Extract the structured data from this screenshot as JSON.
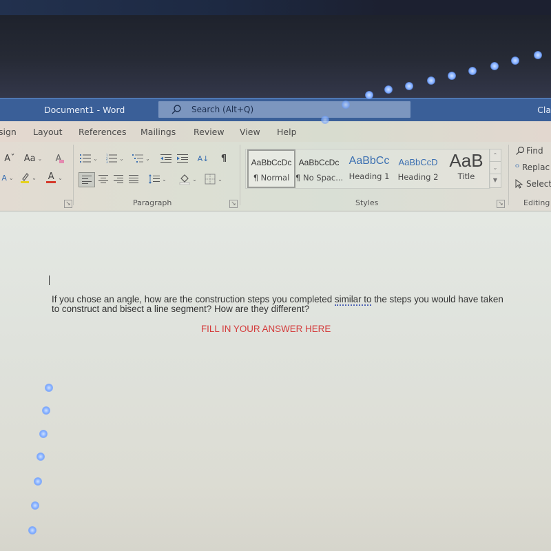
{
  "window": {
    "doc_title": "Document1  -  Word",
    "search_placeholder": "Search (Alt+Q)",
    "user_name_partial": "Cla"
  },
  "ribbon_tabs": [
    {
      "label": "sign"
    },
    {
      "label": "Layout"
    },
    {
      "label": "References"
    },
    {
      "label": "Mailings"
    },
    {
      "label": "Review"
    },
    {
      "label": "View"
    },
    {
      "label": "Help"
    }
  ],
  "font_group": {
    "grow_font": "Aˇ",
    "change_case": "Aa",
    "clear_formatting": "A",
    "font_color": "A",
    "highlight_color": "#e6d21e",
    "font_color_swatch": "#d53a2b"
  },
  "paragraph_group": {
    "label": "Paragraph",
    "sort": "A↓",
    "show_marks": "¶"
  },
  "styles_group": {
    "label": "Styles",
    "items": [
      {
        "preview": "AaBbCcDc",
        "name": "¶ Normal",
        "selected": true
      },
      {
        "preview": "AaBbCcDc",
        "name": "¶ No Spac...",
        "selected": false
      },
      {
        "preview": "AaBbCc",
        "name": "Heading 1",
        "selected": false
      },
      {
        "preview": "AaBbCcD",
        "name": "Heading 2",
        "selected": false
      },
      {
        "preview": "AaB",
        "name": "Title",
        "selected": false
      }
    ]
  },
  "editing_group": {
    "label": "Editing",
    "find": "Find",
    "replace": "Replac",
    "select": "Select"
  },
  "document": {
    "question_part1": "If you chose an angle, how are the construction steps you completed ",
    "question_flagged": "similar to",
    "question_part2": " the steps you would have taken to construct and bisect a line segment? How are they different?",
    "answer_prompt": "FILL IN YOUR ANSWER HERE",
    "answer_color": "#d43a3a"
  }
}
